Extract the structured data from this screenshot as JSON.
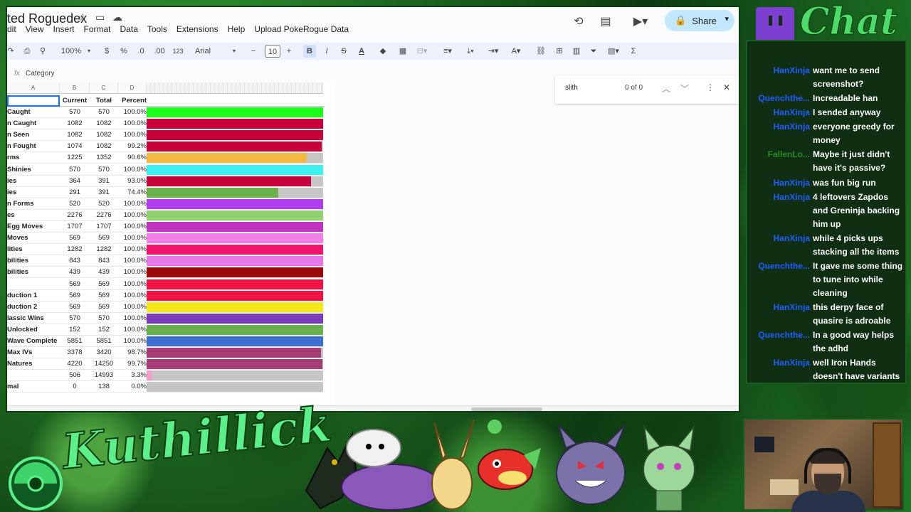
{
  "sheet": {
    "title": "ted Roguedex",
    "menu": [
      "dit",
      "View",
      "Insert",
      "Format",
      "Data",
      "Tools",
      "Extensions",
      "Help",
      "Upload PokeRogue Data"
    ],
    "share_label": "Share",
    "toolbar": {
      "zoom": "100%",
      "currency": "$",
      "percent": "%",
      "decrease_decimals": ".0",
      "increase_decimals": ".00",
      "number_format": "123",
      "font": "Arial",
      "font_size": "10",
      "bold": "B",
      "italic": "I",
      "strikethrough": "S",
      "text_color": "A",
      "sum": "Σ"
    },
    "formula": {
      "fx": "fx",
      "value": "Category"
    },
    "find": {
      "query": "slith",
      "count": "0 of 0"
    },
    "columns": [
      "A",
      "B",
      "C",
      "D"
    ],
    "header": {
      "category": "",
      "current": "Current",
      "total": "Total",
      "percent": "Percent"
    },
    "rows": [
      {
        "category": "Caught",
        "current": "570",
        "total": "570",
        "percent": "100.0%",
        "fill": 1.0,
        "color": "#1aff1a"
      },
      {
        "category": "n Caught",
        "current": "1082",
        "total": "1082",
        "percent": "100.0%",
        "fill": 1.0,
        "color": "#c8003c"
      },
      {
        "category": "n Seen",
        "current": "1082",
        "total": "1082",
        "percent": "100.0%",
        "fill": 1.0,
        "color": "#c8003c"
      },
      {
        "category": "n Fought",
        "current": "1074",
        "total": "1082",
        "percent": "99.2%",
        "fill": 0.992,
        "color": "#c8003c"
      },
      {
        "category": "rms",
        "current": "1225",
        "total": "1352",
        "percent": "90.6%",
        "fill": 0.906,
        "color": "#f5b942"
      },
      {
        "category": "Shinies",
        "current": "570",
        "total": "570",
        "percent": "100.0%",
        "fill": 1.0,
        "color": "#3ef0f0"
      },
      {
        "category": "ies",
        "current": "364",
        "total": "391",
        "percent": "93.0%",
        "fill": 0.93,
        "color": "#c8003c"
      },
      {
        "category": "ies",
        "current": "291",
        "total": "391",
        "percent": "74.4%",
        "fill": 0.744,
        "color": "#6ab04c"
      },
      {
        "category": "n Forms",
        "current": "520",
        "total": "520",
        "percent": "100.0%",
        "fill": 1.0,
        "color": "#b03cf0"
      },
      {
        "category": "es",
        "current": "2276",
        "total": "2276",
        "percent": "100.0%",
        "fill": 1.0,
        "color": "#90d070"
      },
      {
        "category": "Egg Moves",
        "current": "1707",
        "total": "1707",
        "percent": "100.0%",
        "fill": 1.0,
        "color": "#c034c0"
      },
      {
        "category": "Moves",
        "current": "569",
        "total": "569",
        "percent": "100.0%",
        "fill": 1.0,
        "color": "#f080e8"
      },
      {
        "category": "lities",
        "current": "1282",
        "total": "1282",
        "percent": "100.0%",
        "fill": 1.0,
        "color": "#f0146a"
      },
      {
        "category": "bilities",
        "current": "843",
        "total": "843",
        "percent": "100.0%",
        "fill": 1.0,
        "color": "#e878e8"
      },
      {
        "category": "bilities",
        "current": "439",
        "total": "439",
        "percent": "100.0%",
        "fill": 1.0,
        "color": "#9a0a0a"
      },
      {
        "category": "",
        "current": "569",
        "total": "569",
        "percent": "100.0%",
        "fill": 1.0,
        "color": "#f01446"
      },
      {
        "category": "duction 1",
        "current": "569",
        "total": "569",
        "percent": "100.0%",
        "fill": 1.0,
        "color": "#f01446"
      },
      {
        "category": "duction 2",
        "current": "569",
        "total": "569",
        "percent": "100.0%",
        "fill": 1.0,
        "color": "#f5e81a"
      },
      {
        "category": "lassic Wins",
        "current": "570",
        "total": "570",
        "percent": "100.0%",
        "fill": 1.0,
        "color": "#7b3cb8"
      },
      {
        "category": "Unlocked",
        "current": "152",
        "total": "152",
        "percent": "100.0%",
        "fill": 1.0,
        "color": "#6ab04c"
      },
      {
        "category": "Wave Complete",
        "current": "5851",
        "total": "5851",
        "percent": "100.0%",
        "fill": 1.0,
        "color": "#3c6ed0"
      },
      {
        "category": "Max IVs",
        "current": "3378",
        "total": "3420",
        "percent": "98.7%",
        "fill": 0.987,
        "color": "#a83c78"
      },
      {
        "category": "Natures",
        "current": "4220",
        "total": "14250",
        "percent": "99.7%",
        "fill": 0.997,
        "color": "#a83c78"
      },
      {
        "category": "",
        "current": "506",
        "total": "14993",
        "percent": "3.3%",
        "fill": 0.033,
        "color": "#f0a0c8"
      },
      {
        "category": "mal",
        "current": "0",
        "total": "138",
        "percent": "0.0%",
        "fill": 0.0,
        "color": "#c6c6c6"
      }
    ]
  },
  "chat": {
    "logo": "Chat",
    "messages": [
      {
        "user": "HanXinja",
        "text": "want me to send screenshot?",
        "color": "#1f5cff"
      },
      {
        "user": "Quenchthe...",
        "text": "Increadable han",
        "color": "#1f5cff"
      },
      {
        "user": "HanXinja",
        "text": "I sended anyway",
        "color": "#1f5cff"
      },
      {
        "user": "HanXinja",
        "text": "everyone greedy for money",
        "color": "#1f5cff"
      },
      {
        "user": "FallenLo...",
        "text": "Maybe it just didn't have it's passive?",
        "color": "#2a8a2a"
      },
      {
        "user": "HanXinja",
        "text": "was fun big run",
        "color": "#1f5cff"
      },
      {
        "user": "HanXinja",
        "text": "4 leftovers Zapdos and Greninja backing him up",
        "color": "#1f5cff"
      },
      {
        "user": "HanXinja",
        "text": "while 4 picks ups stacking all the items",
        "color": "#1f5cff"
      },
      {
        "user": "Quenchthe...",
        "text": "It gave me some thing to tune into while cleaning",
        "color": "#1f5cff"
      },
      {
        "user": "HanXinja",
        "text": "this derpy face of quasire is adroable",
        "color": "#1f5cff"
      },
      {
        "user": "Quenchthe...",
        "text": "In a good way helps the adhd",
        "color": "#1f5cff"
      },
      {
        "user": "HanXinja",
        "text": "well Iron Hands doesn't have variants",
        "color": "#1f5cff"
      }
    ]
  },
  "banner": {
    "streamer": "Kuthillick"
  },
  "icons": {
    "star": "star-icon",
    "folder": "folder-icon",
    "cloud": "cloud-icon",
    "history": "history-icon",
    "comment": "comment-icon",
    "video": "video-icon",
    "lock": "lock-icon",
    "print": "print-icon",
    "paint": "paint-format-icon",
    "search": "search-icon",
    "close": "close-icon",
    "more": "more-vert-icon"
  }
}
